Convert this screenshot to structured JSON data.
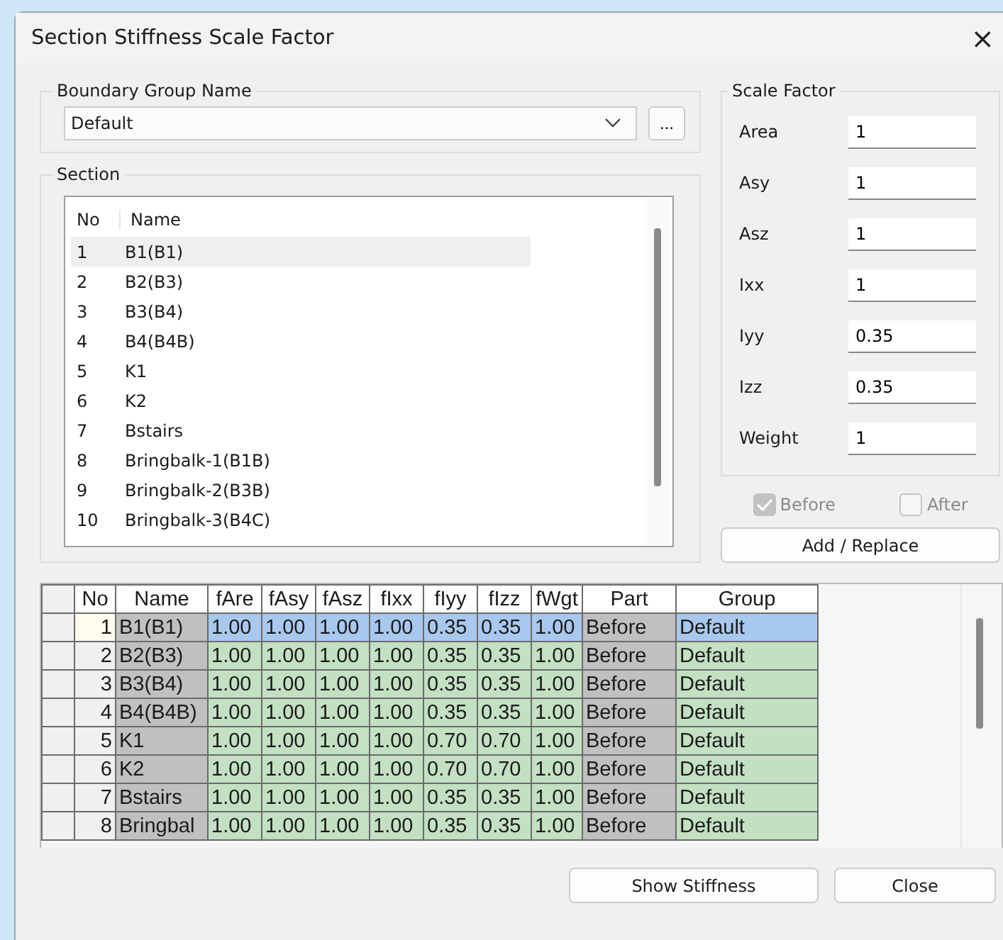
{
  "window": {
    "title": "Section Stiffness Scale Factor",
    "close": "×"
  },
  "boundary_group": {
    "label": "Boundary Group Name",
    "value": "Default",
    "browse": "..."
  },
  "section": {
    "label": "Section",
    "columns": [
      "No",
      "Name"
    ],
    "rows": [
      {
        "no": "1",
        "name": "B1(B1)",
        "selected": true
      },
      {
        "no": "2",
        "name": "B2(B3)",
        "selected": false
      },
      {
        "no": "3",
        "name": "B3(B4)",
        "selected": false
      },
      {
        "no": "4",
        "name": "B4(B4B)",
        "selected": false
      },
      {
        "no": "5",
        "name": "K1",
        "selected": false
      },
      {
        "no": "6",
        "name": "K2",
        "selected": false
      },
      {
        "no": "7",
        "name": "Bstairs",
        "selected": false
      },
      {
        "no": "8",
        "name": "Bringbalk-1(B1B)",
        "selected": false
      },
      {
        "no": "9",
        "name": "Bringbalk-2(B3B)",
        "selected": false
      },
      {
        "no": "10",
        "name": "Bringbalk-3(B4C)",
        "selected": false
      }
    ]
  },
  "scale_factor": {
    "label": "Scale Factor",
    "fields": [
      {
        "label": "Area",
        "value": "1"
      },
      {
        "label": "Asy",
        "value": "1"
      },
      {
        "label": "Asz",
        "value": "1"
      },
      {
        "label": "Ixx",
        "value": "1"
      },
      {
        "label": "Iyy",
        "value": "0.35"
      },
      {
        "label": "Izz",
        "value": "0.35"
      },
      {
        "label": "Weight",
        "value": "1"
      }
    ]
  },
  "options": [
    {
      "label": "Before",
      "checked": true,
      "disabled": true
    },
    {
      "label": "After",
      "checked": false,
      "disabled": true
    }
  ],
  "add_button": "Add / Replace",
  "table": {
    "columns": [
      "No",
      "Name",
      "fAre",
      "fAsy",
      "fAsz",
      "fIxx",
      "fIyy",
      "fIzz",
      "fWgt",
      "Part",
      "Group"
    ],
    "rows": [
      {
        "no": "1",
        "name": "B1(B1)",
        "values": [
          "1.00",
          "1.00",
          "1.00",
          "1.00",
          "0.35",
          "0.35",
          "1.00"
        ],
        "part": "Before",
        "group": "Default",
        "selected": true
      },
      {
        "no": "2",
        "name": "B2(B3)",
        "values": [
          "1.00",
          "1.00",
          "1.00",
          "1.00",
          "0.35",
          "0.35",
          "1.00"
        ],
        "part": "Before",
        "group": "Default",
        "selected": false
      },
      {
        "no": "3",
        "name": "B3(B4)",
        "values": [
          "1.00",
          "1.00",
          "1.00",
          "1.00",
          "0.35",
          "0.35",
          "1.00"
        ],
        "part": "Before",
        "group": "Default",
        "selected": false
      },
      {
        "no": "4",
        "name": "B4(B4B)",
        "values": [
          "1.00",
          "1.00",
          "1.00",
          "1.00",
          "0.35",
          "0.35",
          "1.00"
        ],
        "part": "Before",
        "group": "Default",
        "selected": false
      },
      {
        "no": "5",
        "name": "K1",
        "values": [
          "1.00",
          "1.00",
          "1.00",
          "1.00",
          "0.70",
          "0.70",
          "1.00"
        ],
        "part": "Before",
        "group": "Default",
        "selected": false
      },
      {
        "no": "6",
        "name": "K2",
        "values": [
          "1.00",
          "1.00",
          "1.00",
          "1.00",
          "0.70",
          "0.70",
          "1.00"
        ],
        "part": "Before",
        "group": "Default",
        "selected": false
      },
      {
        "no": "7",
        "name": "Bstairs",
        "values": [
          "1.00",
          "1.00",
          "1.00",
          "1.00",
          "0.35",
          "0.35",
          "1.00"
        ],
        "part": "Before",
        "group": "Default",
        "selected": false
      },
      {
        "no": "8",
        "name": "Bringbal",
        "values": [
          "1.00",
          "1.00",
          "1.00",
          "1.00",
          "0.35",
          "0.35",
          "1.00"
        ],
        "part": "Before",
        "group": "Default",
        "selected": false
      }
    ]
  },
  "buttons": [
    "Show Stiffness",
    "Close"
  ]
}
